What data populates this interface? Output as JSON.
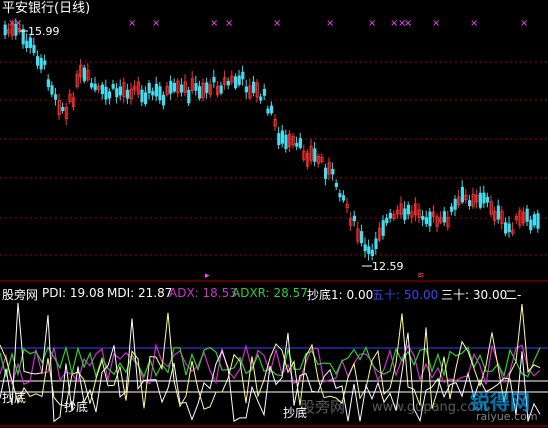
{
  "title": "平安银行(日线)",
  "price_labels": {
    "high": "15.99",
    "low": "12.59"
  },
  "indicator": {
    "name": "股旁网",
    "items": [
      {
        "label": "PDI: 19.08",
        "color": "#ffffff"
      },
      {
        "label": "MDI: 21.87",
        "color": "#ffffff"
      },
      {
        "label": "ADX: 18.53",
        "color": "#cc33cc"
      },
      {
        "label": "ADXR: 28.57",
        "color": "#33cc33"
      },
      {
        "label": "抄底1: 0.00",
        "color": "#ffffff"
      },
      {
        "label": "五十: 50.00",
        "color": "#3344ff"
      },
      {
        "label": "三十: 30.00",
        "color": "#ffffff"
      },
      {
        "label": "二-",
        "color": "#ffffff"
      }
    ]
  },
  "annotations": [
    "抄底",
    "抄底",
    "抄底"
  ],
  "watermarks": [
    "股旁网",
    "www.gupang.com",
    "锐得网",
    "raiyue.com"
  ],
  "colors": {
    "up": "#ff3333",
    "down": "#44ddee",
    "grid": "#aa0000",
    "adx": "#cc33cc",
    "adxr": "#33cc33",
    "fifty": "#3344ff"
  }
}
